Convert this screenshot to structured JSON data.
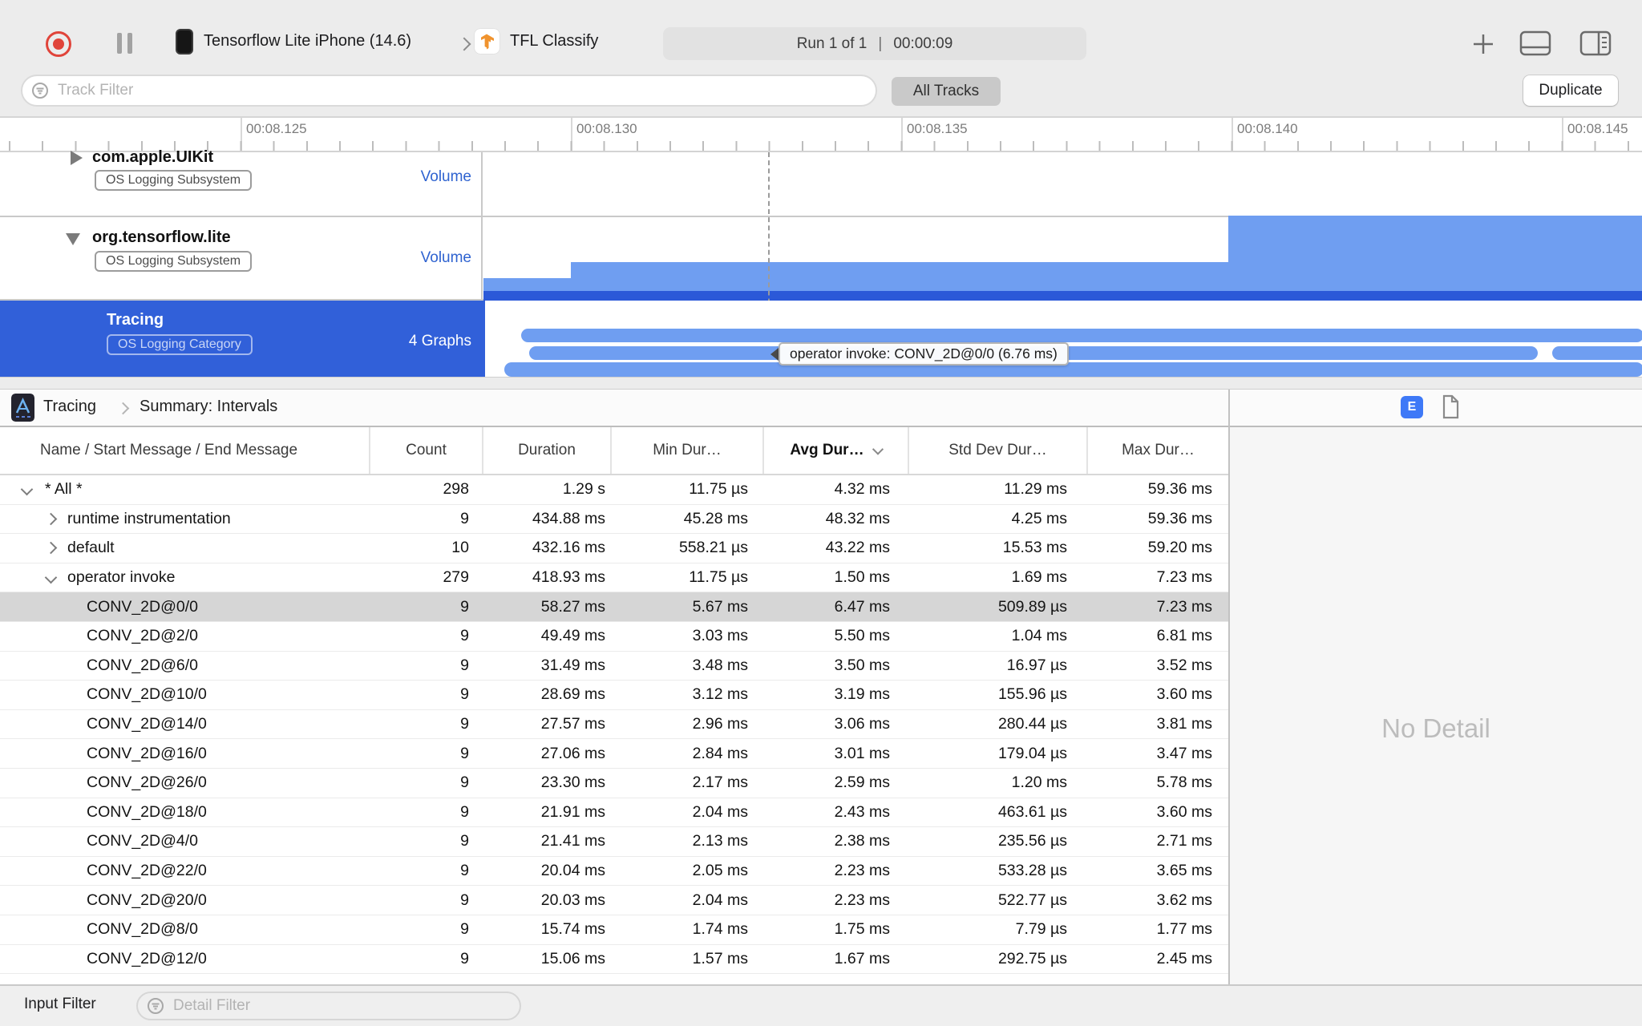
{
  "toolbar": {
    "device": "Tensorflow Lite iPhone (14.6)",
    "target": "TFL Classify",
    "run_label": "Run 1 of 1",
    "run_sep": "|",
    "run_time": "00:00:09"
  },
  "filter_bar": {
    "track_filter_placeholder": "Track Filter",
    "all_tracks_label": "All Tracks",
    "duplicate_label": "Duplicate"
  },
  "ruler": {
    "labels": [
      "00:08.125",
      "00:08.130",
      "00:08.135",
      "00:08.140",
      "00:08.145"
    ]
  },
  "tracks": [
    {
      "name": "com.apple.UIKit",
      "badge": "OS Logging Subsystem",
      "meta": "Volume"
    },
    {
      "name": "org.tensorflow.lite",
      "badge": "OS Logging Subsystem",
      "meta": "Volume"
    },
    {
      "name": "Tracing",
      "badge": "OS Logging Category",
      "meta": "4 Graphs"
    }
  ],
  "tooltip": {
    "text": "operator invoke: CONV_2D@0/0 (6.76 ms)"
  },
  "breadcrumb": {
    "instrument": "Tracing",
    "view": "Summary: Intervals",
    "e_badge": "E"
  },
  "detail": {
    "empty_text": "No Detail"
  },
  "table": {
    "columns": [
      "Name / Start Message / End Message",
      "Count",
      "Duration",
      "Min Dur…",
      "Avg Dur…",
      "Std Dev Dur…",
      "Max Dur…"
    ],
    "sorted_column": "Avg Dur…",
    "rows": [
      {
        "level": 0,
        "expander": "expanded",
        "name": "* All *",
        "count": "298",
        "duration": "1.29 s",
        "min": "11.75 µs",
        "avg": "4.32 ms",
        "std": "11.29 ms",
        "max": "59.36 ms",
        "selected": false
      },
      {
        "level": 1,
        "expander": "collapsed",
        "name": "runtime instrumentation",
        "count": "9",
        "duration": "434.88 ms",
        "min": "45.28 ms",
        "avg": "48.32 ms",
        "std": "4.25 ms",
        "max": "59.36 ms",
        "selected": false
      },
      {
        "level": 1,
        "expander": "collapsed",
        "name": "default",
        "count": "10",
        "duration": "432.16 ms",
        "min": "558.21 µs",
        "avg": "43.22 ms",
        "std": "15.53 ms",
        "max": "59.20 ms",
        "selected": false
      },
      {
        "level": 1,
        "expander": "expanded",
        "name": "operator invoke",
        "count": "279",
        "duration": "418.93 ms",
        "min": "11.75 µs",
        "avg": "1.50 ms",
        "std": "1.69 ms",
        "max": "7.23 ms",
        "selected": false
      },
      {
        "level": 2,
        "expander": null,
        "name": "CONV_2D@0/0",
        "count": "9",
        "duration": "58.27 ms",
        "min": "5.67 ms",
        "avg": "6.47 ms",
        "std": "509.89 µs",
        "max": "7.23 ms",
        "selected": true
      },
      {
        "level": 2,
        "expander": null,
        "name": "CONV_2D@2/0",
        "count": "9",
        "duration": "49.49 ms",
        "min": "3.03 ms",
        "avg": "5.50 ms",
        "std": "1.04 ms",
        "max": "6.81 ms",
        "selected": false
      },
      {
        "level": 2,
        "expander": null,
        "name": "CONV_2D@6/0",
        "count": "9",
        "duration": "31.49 ms",
        "min": "3.48 ms",
        "avg": "3.50 ms",
        "std": "16.97 µs",
        "max": "3.52 ms",
        "selected": false
      },
      {
        "level": 2,
        "expander": null,
        "name": "CONV_2D@10/0",
        "count": "9",
        "duration": "28.69 ms",
        "min": "3.12 ms",
        "avg": "3.19 ms",
        "std": "155.96 µs",
        "max": "3.60 ms",
        "selected": false
      },
      {
        "level": 2,
        "expander": null,
        "name": "CONV_2D@14/0",
        "count": "9",
        "duration": "27.57 ms",
        "min": "2.96 ms",
        "avg": "3.06 ms",
        "std": "280.44 µs",
        "max": "3.81 ms",
        "selected": false
      },
      {
        "level": 2,
        "expander": null,
        "name": "CONV_2D@16/0",
        "count": "9",
        "duration": "27.06 ms",
        "min": "2.84 ms",
        "avg": "3.01 ms",
        "std": "179.04 µs",
        "max": "3.47 ms",
        "selected": false
      },
      {
        "level": 2,
        "expander": null,
        "name": "CONV_2D@26/0",
        "count": "9",
        "duration": "23.30 ms",
        "min": "2.17 ms",
        "avg": "2.59 ms",
        "std": "1.20 ms",
        "max": "5.78 ms",
        "selected": false
      },
      {
        "level": 2,
        "expander": null,
        "name": "CONV_2D@18/0",
        "count": "9",
        "duration": "21.91 ms",
        "min": "2.04 ms",
        "avg": "2.43 ms",
        "std": "463.61 µs",
        "max": "3.60 ms",
        "selected": false
      },
      {
        "level": 2,
        "expander": null,
        "name": "CONV_2D@4/0",
        "count": "9",
        "duration": "21.41 ms",
        "min": "2.13 ms",
        "avg": "2.38 ms",
        "std": "235.56 µs",
        "max": "2.71 ms",
        "selected": false
      },
      {
        "level": 2,
        "expander": null,
        "name": "CONV_2D@22/0",
        "count": "9",
        "duration": "20.04 ms",
        "min": "2.05 ms",
        "avg": "2.23 ms",
        "std": "533.28 µs",
        "max": "3.65 ms",
        "selected": false
      },
      {
        "level": 2,
        "expander": null,
        "name": "CONV_2D@20/0",
        "count": "9",
        "duration": "20.03 ms",
        "min": "2.04 ms",
        "avg": "2.23 ms",
        "std": "522.77 µs",
        "max": "3.62 ms",
        "selected": false
      },
      {
        "level": 2,
        "expander": null,
        "name": "CONV_2D@8/0",
        "count": "9",
        "duration": "15.74 ms",
        "min": "1.74 ms",
        "avg": "1.75 ms",
        "std": "7.79 µs",
        "max": "1.77 ms",
        "selected": false
      },
      {
        "level": 2,
        "expander": null,
        "name": "CONV_2D@12/0",
        "count": "9",
        "duration": "15.06 ms",
        "min": "1.57 ms",
        "avg": "1.67 ms",
        "std": "292.75 µs",
        "max": "2.45 ms",
        "selected": false
      }
    ]
  },
  "bottom_bar": {
    "label": "Input Filter",
    "detail_filter_placeholder": "Detail Filter"
  },
  "colors": {
    "accent_blue": "#3160d9",
    "bar_blue": "#6f9ef1",
    "selected_row": "#d6d6d6",
    "record_red": "#e0443a"
  }
}
